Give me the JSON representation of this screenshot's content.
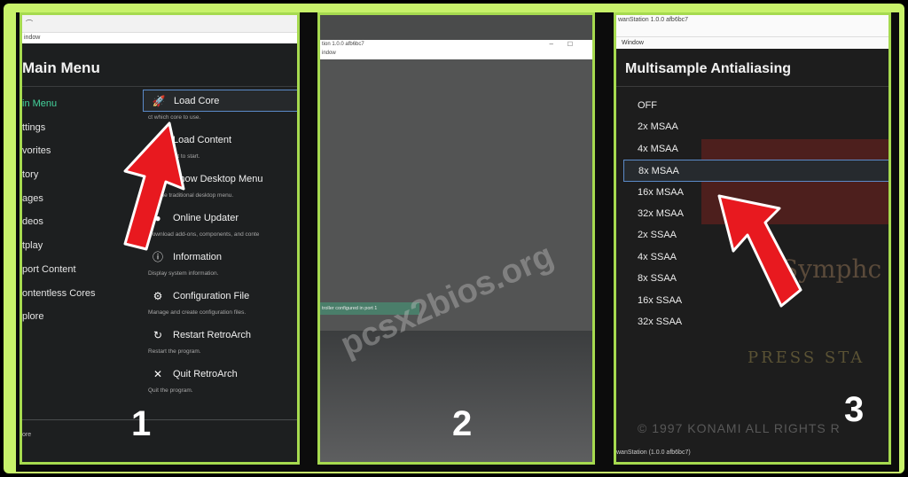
{
  "panel1": {
    "window_title_fragment": "⌒",
    "window_menu": "indow",
    "title": "Main Menu",
    "sidebar": [
      {
        "label": "in Menu",
        "active": true
      },
      {
        "label": "ttings"
      },
      {
        "label": "vorites"
      },
      {
        "label": "tory"
      },
      {
        "label": "ages"
      },
      {
        "label": "deos"
      },
      {
        "label": "tplay"
      },
      {
        "label": "port Content"
      },
      {
        "label": "ontentless Cores"
      },
      {
        "label": "plore"
      }
    ],
    "menu": [
      {
        "icon": "rocket-icon",
        "glyph": "🚀",
        "label": "Load Core",
        "desc": "ct which core to use.",
        "selected": true
      },
      {
        "icon": "file-icon",
        "glyph": "",
        "label": "Load Content",
        "desc": "hich content to start."
      },
      {
        "icon": "desktop-icon",
        "glyph": "▮",
        "label": "Show Desktop Menu",
        "desc": "pen the traditional desktop menu."
      },
      {
        "icon": "globe-icon",
        "glyph": "●",
        "label": "Online Updater",
        "desc": "Download add-ons, components, and conte"
      },
      {
        "icon": "info-icon",
        "glyph": "ⓘ",
        "label": "Information",
        "desc": "Display system information."
      },
      {
        "icon": "gears-icon",
        "glyph": "⚙",
        "label": "Configuration File",
        "desc": "Manage and create configuration files."
      },
      {
        "icon": "restart-icon",
        "glyph": "↻",
        "label": "Restart RetroArch",
        "desc": "Restart the program."
      },
      {
        "icon": "close-icon",
        "glyph": "✕",
        "label": "Quit RetroArch",
        "desc": "Quit the program."
      }
    ],
    "footer": "ore",
    "number": "1"
  },
  "panel2": {
    "window_title": "tion 1.0.0 afb6bc7",
    "window_menu": "indow",
    "minimize": "–",
    "maximize": "☐",
    "toast": "troller configured in port 1",
    "number": "2"
  },
  "panel3": {
    "window_title": "wanStation 1.0.0 afb6bc7",
    "window_menu": "Window",
    "title": "Multisample Antialiasing",
    "options": [
      "OFF",
      "2x MSAA",
      "4x MSAA",
      "8x MSAA",
      "16x MSAA",
      "32x MSAA",
      "2x SSAA",
      "4x SSAA",
      "8x SSAA",
      "16x SSAA",
      "32x SSAA"
    ],
    "selected_index": 3,
    "bg_text": [
      "Symphc",
      "PRESS STA",
      "© 1997 KONAMI ALL RIGHTS R"
    ],
    "footer": "wanStation (1.0.0 afb6bc7)",
    "number": "3"
  },
  "watermark": "pcsx2bios.org",
  "colors": {
    "accent_green": "#44d39c",
    "frame": "#c8f26a",
    "arrow": "#e8191f",
    "selection": "#5b8ac8"
  }
}
